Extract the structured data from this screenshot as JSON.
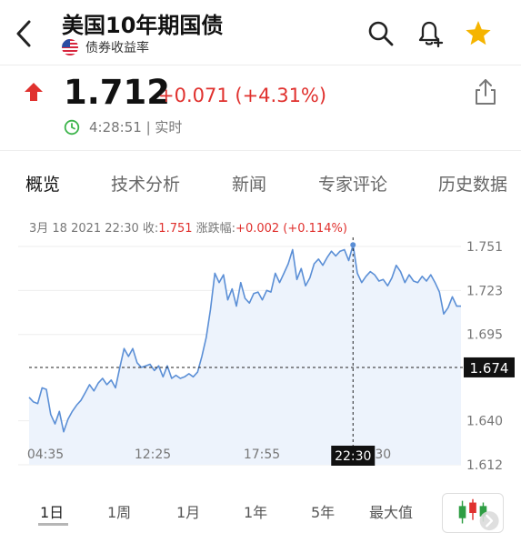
{
  "header": {
    "title": "美国10年期国债",
    "subtitle": "债券收益率",
    "colors": {
      "star": "#f5b400",
      "icon": "#222222"
    }
  },
  "quote": {
    "price": "1.712",
    "change": "+0.071 (+4.31%)",
    "time": "4:28:51 | 实时",
    "colors": {
      "up": "#e0312e",
      "clock": "#3cb44b"
    }
  },
  "tabs": [
    {
      "label": "概览"
    },
    {
      "label": "技术分析"
    },
    {
      "label": "新闻"
    },
    {
      "label": "专家评论"
    },
    {
      "label": "历史数据"
    }
  ],
  "chart_info": {
    "date": "3月 18 2021 22:30",
    "close_label": "收:",
    "close_value": "1.751",
    "change_label": "涨跌幅:",
    "change_value": "+0.002 (+0.114%)"
  },
  "ranges": [
    {
      "label": "1日"
    },
    {
      "label": "1周"
    },
    {
      "label": "1月"
    },
    {
      "label": "1年"
    },
    {
      "label": "5年"
    },
    {
      "label": "最大值"
    }
  ],
  "chart_data": {
    "type": "area",
    "x_labels": [
      "04:35",
      "12:25",
      "17:55",
      "22:30",
      "23:30"
    ],
    "y_ticks": [
      "1.751",
      "1.723",
      "1.695",
      "1.640",
      "1.612"
    ],
    "ylim": [
      1.612,
      1.751
    ],
    "current_value_label": "1.674",
    "crosshair_time_label": "22:30",
    "line_color": "#5b8fd6",
    "fill_color": "#edf3fc",
    "series": [
      {
        "values": [
          1.655,
          1.652,
          1.651,
          1.661,
          1.66,
          1.644,
          1.638,
          1.646,
          1.633,
          1.641,
          1.646,
          1.65,
          1.653,
          1.658,
          1.663,
          1.659,
          1.664,
          1.667,
          1.663,
          1.666,
          1.661,
          1.674,
          1.686,
          1.681,
          1.686,
          1.677,
          1.674,
          1.675,
          1.676,
          1.672,
          1.675,
          1.668,
          1.675,
          1.667,
          1.669,
          1.667,
          1.668,
          1.67,
          1.668,
          1.671,
          1.681,
          1.693,
          1.711,
          1.734,
          1.728,
          1.733,
          1.717,
          1.724,
          1.713,
          1.728,
          1.718,
          1.715,
          1.721,
          1.722,
          1.717,
          1.723,
          1.722,
          1.734,
          1.728,
          1.734,
          1.74,
          1.749,
          1.73,
          1.737,
          1.726,
          1.731,
          1.74,
          1.743,
          1.739,
          1.744,
          1.748,
          1.745,
          1.748,
          1.749,
          1.742,
          1.752,
          1.734,
          1.728,
          1.732,
          1.735,
          1.733,
          1.729,
          1.73,
          1.726,
          1.731,
          1.739,
          1.735,
          1.728,
          1.733,
          1.729,
          1.728,
          1.732,
          1.729,
          1.733,
          1.728,
          1.722,
          1.708,
          1.712,
          1.719,
          1.713,
          1.713
        ]
      }
    ]
  }
}
